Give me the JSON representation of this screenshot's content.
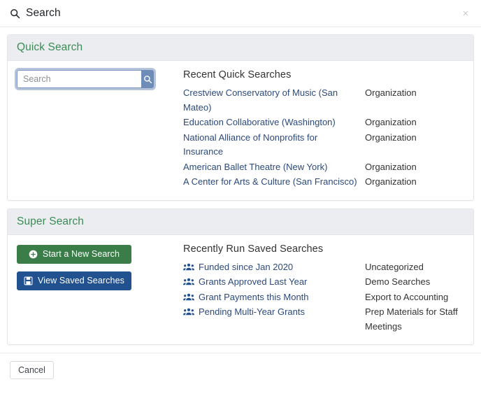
{
  "modal": {
    "title": "Search",
    "title_icon": "search-icon",
    "close_icon": "close-icon",
    "close_label": "×",
    "cancel_label": "Cancel"
  },
  "colors": {
    "panel_heading_bg": "#ecedf1",
    "panel_title_green": "#3b8b55",
    "link_blue": "#2c4a7c",
    "button_green": "#3a7d48",
    "button_blue": "#21518f",
    "search_button_blue": "#6d8cb8"
  },
  "quick_search": {
    "panel_title": "Quick Search",
    "search_input": {
      "placeholder": "Search",
      "value": ""
    },
    "search_button_icon": "search-icon",
    "list_heading": "Recent Quick Searches",
    "items": [
      {
        "name": "Crestview Conservatory of Music (San Mateo)",
        "type": "Organization"
      },
      {
        "name": "Education Collaborative (Washington)",
        "type": "Organization"
      },
      {
        "name": "National Alliance of Nonprofits for Insurance",
        "type": "Organization"
      },
      {
        "name": "American Ballet Theatre (New York)",
        "type": "Organization"
      },
      {
        "name": "A Center for Arts & Culture (San Francisco)",
        "type": "Organization"
      }
    ]
  },
  "super_search": {
    "panel_title": "Super Search",
    "buttons": [
      {
        "label": "Start a New Search",
        "icon": "plus-circle-icon",
        "style": "green"
      },
      {
        "label": "View Saved Searches",
        "icon": "save-icon",
        "style": "blue"
      }
    ],
    "list_heading": "Recently Run Saved Searches",
    "items": [
      {
        "name": "Funded since Jan 2020",
        "category": "Uncategorized",
        "icon": "users-icon"
      },
      {
        "name": "Grants Approved Last Year",
        "category": "Demo Searches",
        "icon": "users-icon"
      },
      {
        "name": "Grant Payments this Month",
        "category": "Export to Accounting",
        "icon": "users-icon"
      },
      {
        "name": "Pending Multi-Year Grants",
        "category": "Prep Materials for Staff Meetings",
        "icon": "users-icon"
      }
    ]
  }
}
